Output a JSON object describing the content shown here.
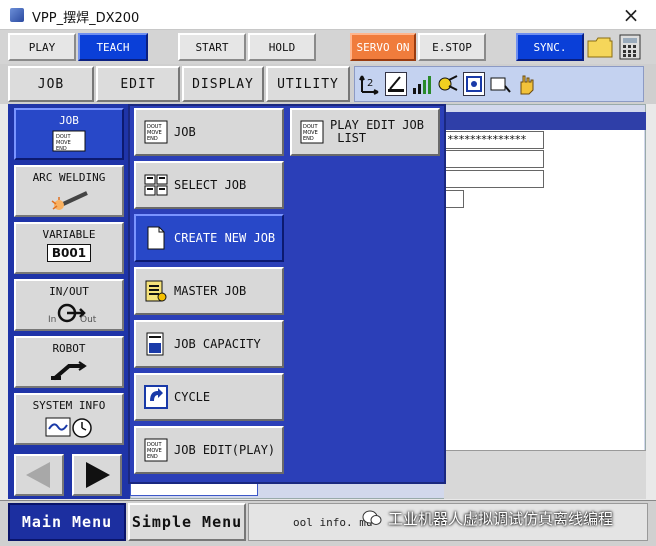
{
  "window": {
    "title": "VPP_摆焊_DX200",
    "close": "×"
  },
  "top_buttons": {
    "play": "PLAY",
    "teach": "TEACH",
    "start": "START",
    "hold": "HOLD",
    "servo_on": "SERVO ON",
    "estop": "E.STOP",
    "sync": "SYNC."
  },
  "menu_tabs": [
    "JOB",
    "EDIT",
    "DISPLAY",
    "UTILITY"
  ],
  "status_icons": [
    "coordinate-icon",
    "edit-lock-icon",
    "signal-icon",
    "welding-icon",
    "cycle-icon",
    "camera-icon",
    "hand-icon"
  ],
  "left_menu": {
    "job": "JOB",
    "job_icon_text": "DOUT\nMOVE\nEND",
    "arc_welding": "ARC WELDING",
    "variable": "VARIABLE",
    "variable_value": "B001",
    "in_out": "IN/OUT",
    "in_label": "In",
    "out_label": "Out",
    "robot": "ROBOT",
    "system_info": "SYSTEM INFO"
  },
  "sub_menu": {
    "job": "JOB",
    "play_edit_job_list": "PLAY EDIT JOB\n LIST",
    "select_job": "SELECT JOB",
    "create_new_job": "CREATE NEW JOB",
    "master_job": "MASTER JOB",
    "job_capacity": "JOB CAPACITY",
    "cycle": "CYCLE",
    "job_edit_play": "JOB EDIT(PLAY)"
  },
  "content": {
    "masked_field": "**************"
  },
  "bottom": {
    "main_menu": "Main Menu",
    "simple_menu": "Simple Menu",
    "message": "ool info. mu",
    "watermark": "工业机器人虚拟调试仿真离线编程"
  },
  "colors": {
    "teach_blue": "#0a3fd8",
    "servo_orange": "#f07c3c",
    "menu_blue": "#2b3fb8",
    "selected_blue": "#2848c8"
  }
}
